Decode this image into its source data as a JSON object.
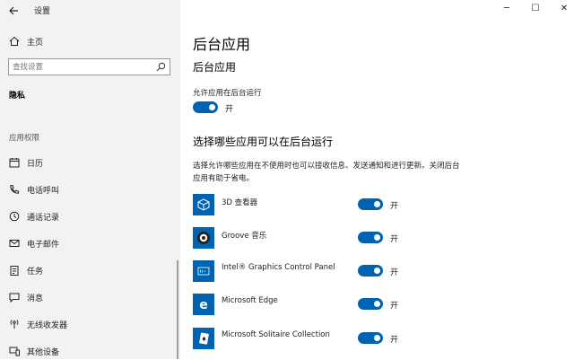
{
  "window": {
    "title": "设置",
    "minimize": "─",
    "maximize": "☐",
    "close": "✕"
  },
  "sidebar": {
    "home_label": "主页",
    "search_placeholder": "查找设置",
    "section": "隐私",
    "group": "应用权限",
    "items": [
      {
        "label": "日历",
        "icon": "calendar-icon"
      },
      {
        "label": "电话呼叫",
        "icon": "phone-icon"
      },
      {
        "label": "通话记录",
        "icon": "history-icon"
      },
      {
        "label": "电子邮件",
        "icon": "mail-icon"
      },
      {
        "label": "任务",
        "icon": "task-icon"
      },
      {
        "label": "消息",
        "icon": "message-icon"
      },
      {
        "label": "无线收发器",
        "icon": "radio-icon"
      },
      {
        "label": "其他设备",
        "icon": "devices-icon"
      }
    ]
  },
  "main": {
    "page_title": "后台应用",
    "section1_title": "后台应用",
    "allow_label": "允许应用在后台运行",
    "allow_state": "开",
    "section2_title": "选择哪些应用可以在后台运行",
    "description": "选择允许哪些应用在不使用时也可以接收信息、发送通知和进行更新。关闭后台应用有助于省电。",
    "apps": [
      {
        "name": "3D 查看器",
        "state": "开",
        "icon": "cube-icon"
      },
      {
        "name": "Groove 音乐",
        "state": "开",
        "icon": "music-icon"
      },
      {
        "name": "Intel® Graphics Control Panel",
        "state": "开",
        "icon": "intel-icon"
      },
      {
        "name": "Microsoft Edge",
        "state": "开",
        "icon": "edge-icon"
      },
      {
        "name": "Microsoft Solitaire Collection",
        "state": "开",
        "icon": "cards-icon"
      }
    ]
  }
}
